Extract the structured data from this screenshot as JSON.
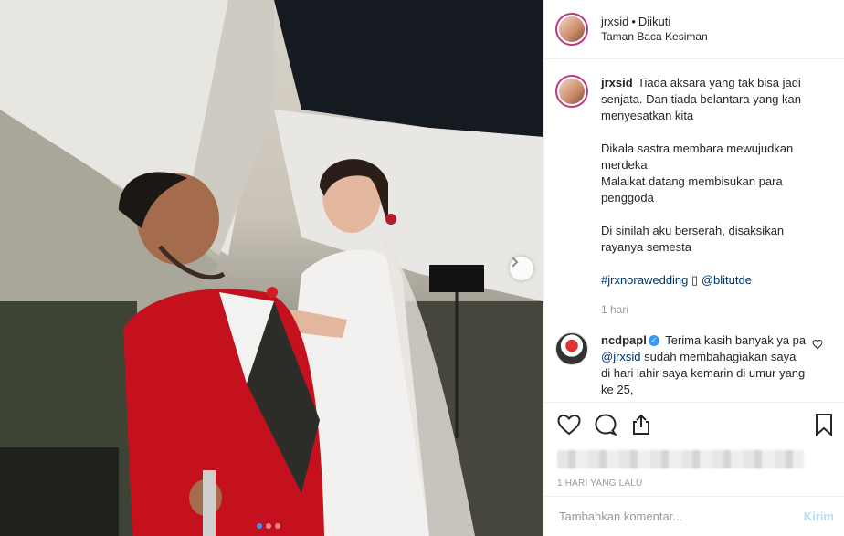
{
  "header": {
    "username": "jrxsid",
    "separator": "•",
    "follow_status": "Diikuti",
    "location": "Taman Baca Kesiman"
  },
  "caption": {
    "username": "jrxsid",
    "paragraphs": [
      "Tiada aksara yang tak bisa jadi senjata. Dan tiada belantara yang kan menyesatkan kita",
      "Dikala sastra membara mewujudkan merdeka\nMalaikat datang membisukan para penggoda",
      "Di sinilah aku berserah, disaksikan rayanya semesta"
    ],
    "hashtag": "#jrxnorawedding",
    "hashtag_emoji": "▯",
    "mention": "@blitutde",
    "time": "1 hari"
  },
  "comment": {
    "username": "ncdpapl",
    "text_pre": "Terima kasih banyak ya pa",
    "mention": "@jrxsid",
    "text_post": "sudah membahagiakan saya di hari lahir saya kemarin di umur yang ke 25,"
  },
  "actions": {
    "icons": [
      "heart-icon",
      "comment-icon",
      "share-icon",
      "bookmark-icon"
    ],
    "posted_time": "1 HARI YANG LALU"
  },
  "add_comment": {
    "placeholder": "Tambahkan komentar...",
    "post_label": "Kirim"
  },
  "carousel": {
    "slide_count": 3,
    "active_index": 0
  },
  "colors": {
    "accent": "#3897f0",
    "story_ring": "#c13584",
    "link": "#003569"
  }
}
